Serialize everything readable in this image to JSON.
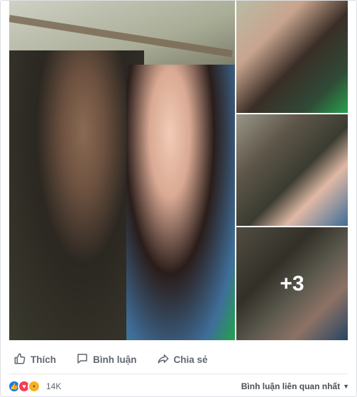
{
  "gallery": {
    "more_count": "+3"
  },
  "actions": {
    "like_label": "Thích",
    "comment_label": "Bình luận",
    "share_label": "Chia sẻ"
  },
  "footer": {
    "reaction_count": "14K",
    "reaction_icons": [
      "like-icon",
      "love-icon",
      "wow-icon"
    ],
    "sort_label": "Bình luận liên quan nhất"
  },
  "colors": {
    "like": "#1877f2",
    "love": "#f33e58",
    "wow": "#f7b125",
    "action_text": "#606770"
  }
}
